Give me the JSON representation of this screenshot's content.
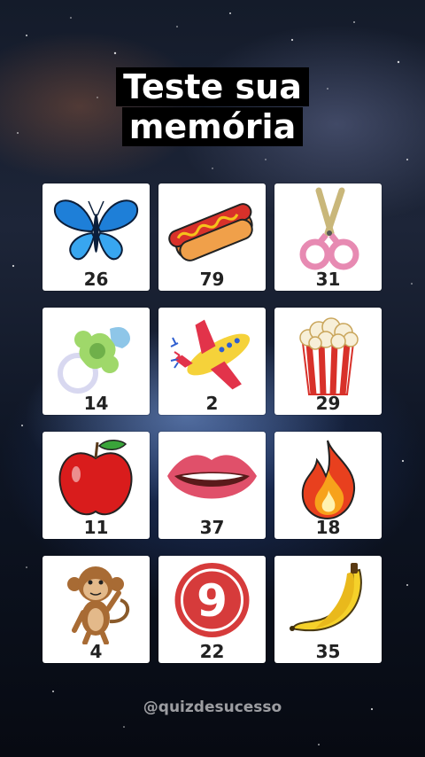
{
  "title_line1": "Teste sua",
  "title_line2": "memória",
  "cards": [
    {
      "icon": "butterfly-icon",
      "number": "26"
    },
    {
      "icon": "hotdog-icon",
      "number": "79"
    },
    {
      "icon": "scissors-icon",
      "number": "31"
    },
    {
      "icon": "pacifier-icon",
      "number": "14"
    },
    {
      "icon": "toy-airplane-icon",
      "number": "2"
    },
    {
      "icon": "popcorn-icon",
      "number": "29"
    },
    {
      "icon": "apple-icon",
      "number": "11"
    },
    {
      "icon": "lips-icon",
      "number": "37"
    },
    {
      "icon": "fire-icon",
      "number": "18"
    },
    {
      "icon": "monkey-icon",
      "number": "4"
    },
    {
      "icon": "number-nine-badge-icon",
      "number": "22"
    },
    {
      "icon": "banana-icon",
      "number": "35"
    }
  ],
  "nine_badge_text": "9",
  "handle": "@quizdesucesso",
  "colors": {
    "card_bg": "#ffffff",
    "title_bg": "#000000",
    "badge_red": "#d63b3b"
  }
}
